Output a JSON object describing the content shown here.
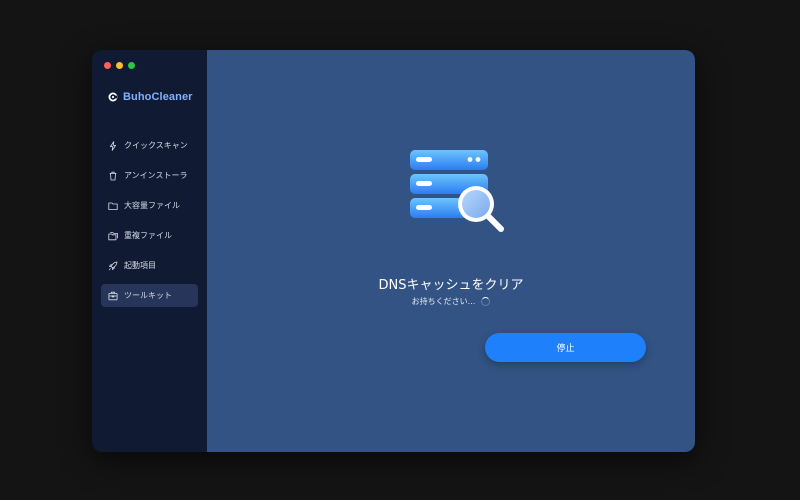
{
  "app": {
    "name": "BuhoCleaner"
  },
  "colors": {
    "sidebar_bg": "#101a33",
    "main_bg": "#325383",
    "accent": "#1f80fc",
    "brand": "#7fb2ff"
  },
  "sidebar": {
    "items": [
      {
        "label": "クイックスキャン",
        "icon": "lightning-icon",
        "active": false
      },
      {
        "label": "アンインストーラ",
        "icon": "trash-icon",
        "active": false
      },
      {
        "label": "大容量ファイル",
        "icon": "folder-icon",
        "active": false
      },
      {
        "label": "重複ファイル",
        "icon": "duplicate-folder-icon",
        "active": false
      },
      {
        "label": "起動項目",
        "icon": "rocket-icon",
        "active": false
      },
      {
        "label": "ツールキット",
        "icon": "toolkit-icon",
        "active": true
      }
    ]
  },
  "main": {
    "title": "DNSキャッシュをクリア",
    "status": "お持ちください...",
    "stop_label": "停止"
  }
}
